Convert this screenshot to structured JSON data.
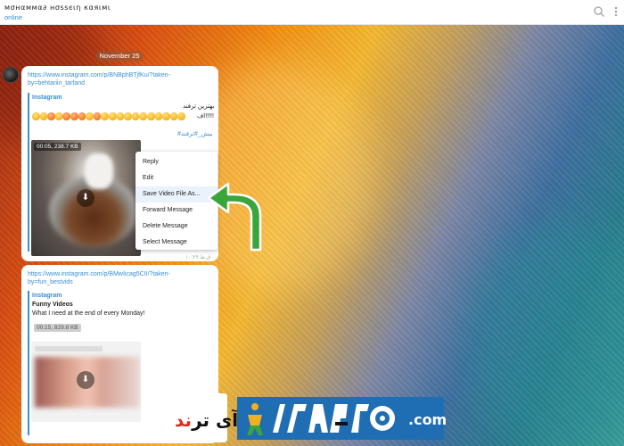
{
  "header": {
    "title": "мσнαммα∂ нσѕѕєιη кαяιмι",
    "status": "online"
  },
  "chat": {
    "date": "November 25",
    "messages": [
      {
        "link": "https://www.instagram.com/p/BNBphBTjfKu/?taken-by=behtariin_tarfand",
        "site": "Instagram",
        "text_rtl": "بهترین ترفند",
        "text_line2": "اف!!!!!",
        "hashtag": "#بیش_#ترفند",
        "video_meta": "00:05, 238.7 KB",
        "time": "۱۰:۲۹ ق.ظ"
      },
      {
        "link": "https://www.instagram.com/p/BMwIicag5CII/?taken-by=fun_bestvids",
        "site": "Instagram",
        "title": "Funny Videos",
        "text": "What I need at the end of every Monday!",
        "video_meta": "00:15, 829.8 KB"
      }
    ]
  },
  "context_menu": {
    "items": [
      "Reply",
      "Edit",
      "Save Video File As...",
      "Forward Message",
      "Delete Message",
      "Select Message"
    ],
    "highlighted_index": 2
  },
  "watermark": {
    "fa_red": "ند",
    "fa_black": "آی تر",
    "brand_letters": "ITRABFAND",
    "domain": ".com"
  },
  "colors": {
    "accent": "#3a8fd6",
    "arrow": "#3aa53a",
    "watermark_bg": "#1f6db2"
  },
  "icons": [
    "search-icon",
    "more-vertical-icon",
    "download-icon",
    "curved-arrow-icon"
  ]
}
